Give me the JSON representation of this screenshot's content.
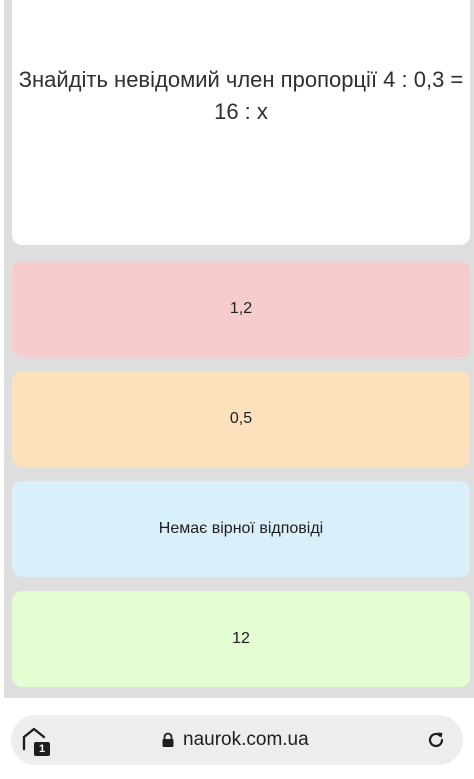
{
  "question": {
    "text": "Знайдіть невідомий член пропорції 4 : 0,3 = 16 : x"
  },
  "answers": [
    {
      "label": "1,2",
      "color": "#f5cccb"
    },
    {
      "label": "0,5",
      "color": "#fbe2bc"
    },
    {
      "label": "Немає вірної відповіді",
      "color": "#d9f0fb"
    },
    {
      "label": "12",
      "color": "#e1fdd1"
    }
  ],
  "browser": {
    "url": "naurok.com.ua",
    "tab_count": "1",
    "icons": {
      "tabs": "tab-switcher-icon",
      "lock": "lock-icon",
      "reload": "reload-icon"
    }
  }
}
